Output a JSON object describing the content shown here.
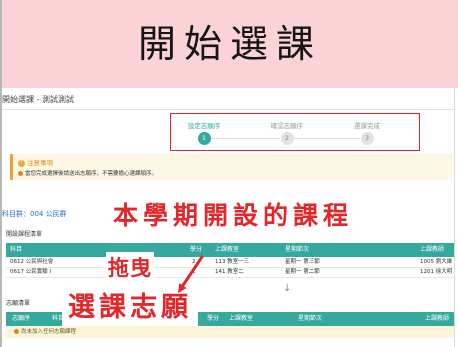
{
  "slide": {
    "title": "開始選課"
  },
  "page": {
    "title": "開始選課 - 測試測試"
  },
  "steps": [
    {
      "label": "設定志願序",
      "num": "1",
      "active": true
    },
    {
      "label": "確認志願序",
      "num": "2",
      "active": false
    },
    {
      "label": "選課完成",
      "num": "3",
      "active": false
    }
  ],
  "notice": {
    "title": "注意事項",
    "text": "當您完成選擇後請送出志願序，不需要擔心選課順序。"
  },
  "subject_group": "科目群：004 公民群",
  "offered": {
    "title": "開設課程清單",
    "headers": {
      "subject": "科目",
      "credits": "學分",
      "room": "上課教室",
      "time": "星期節次",
      "teacher": "上課教師"
    },
    "rows": [
      {
        "subject": "0612 公民與社會",
        "credits": "2",
        "room": "113 教室一三",
        "time": "星期一 第三節",
        "teacher": "1005 劉大維"
      },
      {
        "subject": "0617 公民實驗 I",
        "credits": "2",
        "room": "141 教室二",
        "time": "星期一 第二節",
        "teacher": "1201 徐大明"
      }
    ]
  },
  "wishlist": {
    "title": "志願清單",
    "headers": {
      "order": "志願序",
      "subject": "科目",
      "credits": "學分",
      "room": "上課教室",
      "time": "星期節次",
      "teacher": "上課教師"
    },
    "empty_text": "尚未加入任何志願課程"
  },
  "annotations": {
    "offered_label": "本學期開設的課程",
    "drag_label": "拖曳",
    "wish_label": "選課志願"
  },
  "icons": {
    "notice": "alert-circle-icon",
    "move": "arrow-down-icon",
    "annotation_arrow": "red-arrow-icon"
  },
  "colors": {
    "band": "#f9d3d6",
    "teal": "#35a99d",
    "annotation_red": "#e3262a",
    "notice_orange": "#f0a23a"
  }
}
